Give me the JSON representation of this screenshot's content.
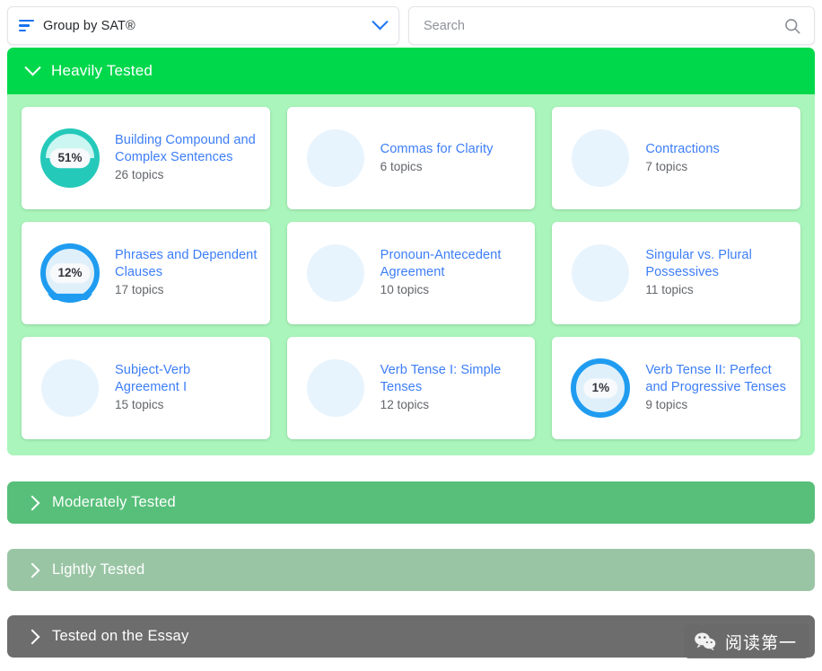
{
  "toolbar": {
    "group_by_label": "Group by SAT®",
    "group_by_icon": "sort-lines-icon",
    "dropdown_icon": "chevron-down-icon",
    "search_placeholder": "Search",
    "search_value": "",
    "search_icon": "search-icon"
  },
  "sections": [
    {
      "id": "heavily-tested",
      "title": "Heavily Tested",
      "expanded": true,
      "caret_icon": "chevron-down-icon",
      "header_color": "#00d84b",
      "body_color": "#aaf5bb",
      "cards": [
        {
          "title": "Building Compound and Complex Sentences",
          "topics": "26 topics",
          "percent": "51%",
          "progress": 51,
          "ring_color": "#25c9ba",
          "track_color": "#ccf6f2",
          "has_progress": true
        },
        {
          "title": "Commas for Clarity",
          "topics": "6 topics",
          "percent": "",
          "progress": 0,
          "ring_color": "",
          "track_color": "#e8f4fd",
          "has_progress": false
        },
        {
          "title": "Contractions",
          "topics": "7 topics",
          "percent": "",
          "progress": 0,
          "ring_color": "",
          "track_color": "#e8f4fd",
          "has_progress": false
        },
        {
          "title": "Phrases and Dependent Clauses",
          "topics": "17 topics",
          "percent": "12%",
          "progress": 12,
          "ring_color": "#1f9cf0",
          "track_color": "#dff0fb",
          "has_progress": true
        },
        {
          "title": "Pronoun-Antecedent Agreement",
          "topics": "10 topics",
          "percent": "",
          "progress": 0,
          "ring_color": "",
          "track_color": "#e8f4fd",
          "has_progress": false
        },
        {
          "title": "Singular vs. Plural Possessives",
          "topics": "11 topics",
          "percent": "",
          "progress": 0,
          "ring_color": "",
          "track_color": "#e8f4fd",
          "has_progress": false
        },
        {
          "title": "Subject-Verb Agreement I",
          "topics": "15 topics",
          "percent": "",
          "progress": 0,
          "ring_color": "",
          "track_color": "#e8f4fd",
          "has_progress": false
        },
        {
          "title": "Verb Tense I: Simple Tenses",
          "topics": "12 topics",
          "percent": "",
          "progress": 0,
          "ring_color": "",
          "track_color": "#e8f4fd",
          "has_progress": false
        },
        {
          "title": "Verb Tense II: Perfect and Progressive Tenses",
          "topics": "9 topics",
          "percent": "1%",
          "progress": 1,
          "ring_color": "#1f9cf0",
          "track_color": "#dff0fb",
          "has_progress": true
        }
      ]
    },
    {
      "id": "moderately-tested",
      "title": "Moderately Tested",
      "expanded": false,
      "caret_icon": "chevron-right-icon",
      "header_color": "#57bf79",
      "cards": []
    },
    {
      "id": "lightly-tested",
      "title": "Lightly Tested",
      "expanded": false,
      "caret_icon": "chevron-right-icon",
      "header_color": "#9ac5a5",
      "cards": []
    },
    {
      "id": "tested-on-the-essay",
      "title": "Tested on the Essay",
      "expanded": false,
      "caret_icon": "chevron-right-icon",
      "header_color": "#6d6d6d",
      "cards": []
    }
  ],
  "watermark": {
    "text": "阅读第一",
    "icon": "wechat-icon"
  }
}
